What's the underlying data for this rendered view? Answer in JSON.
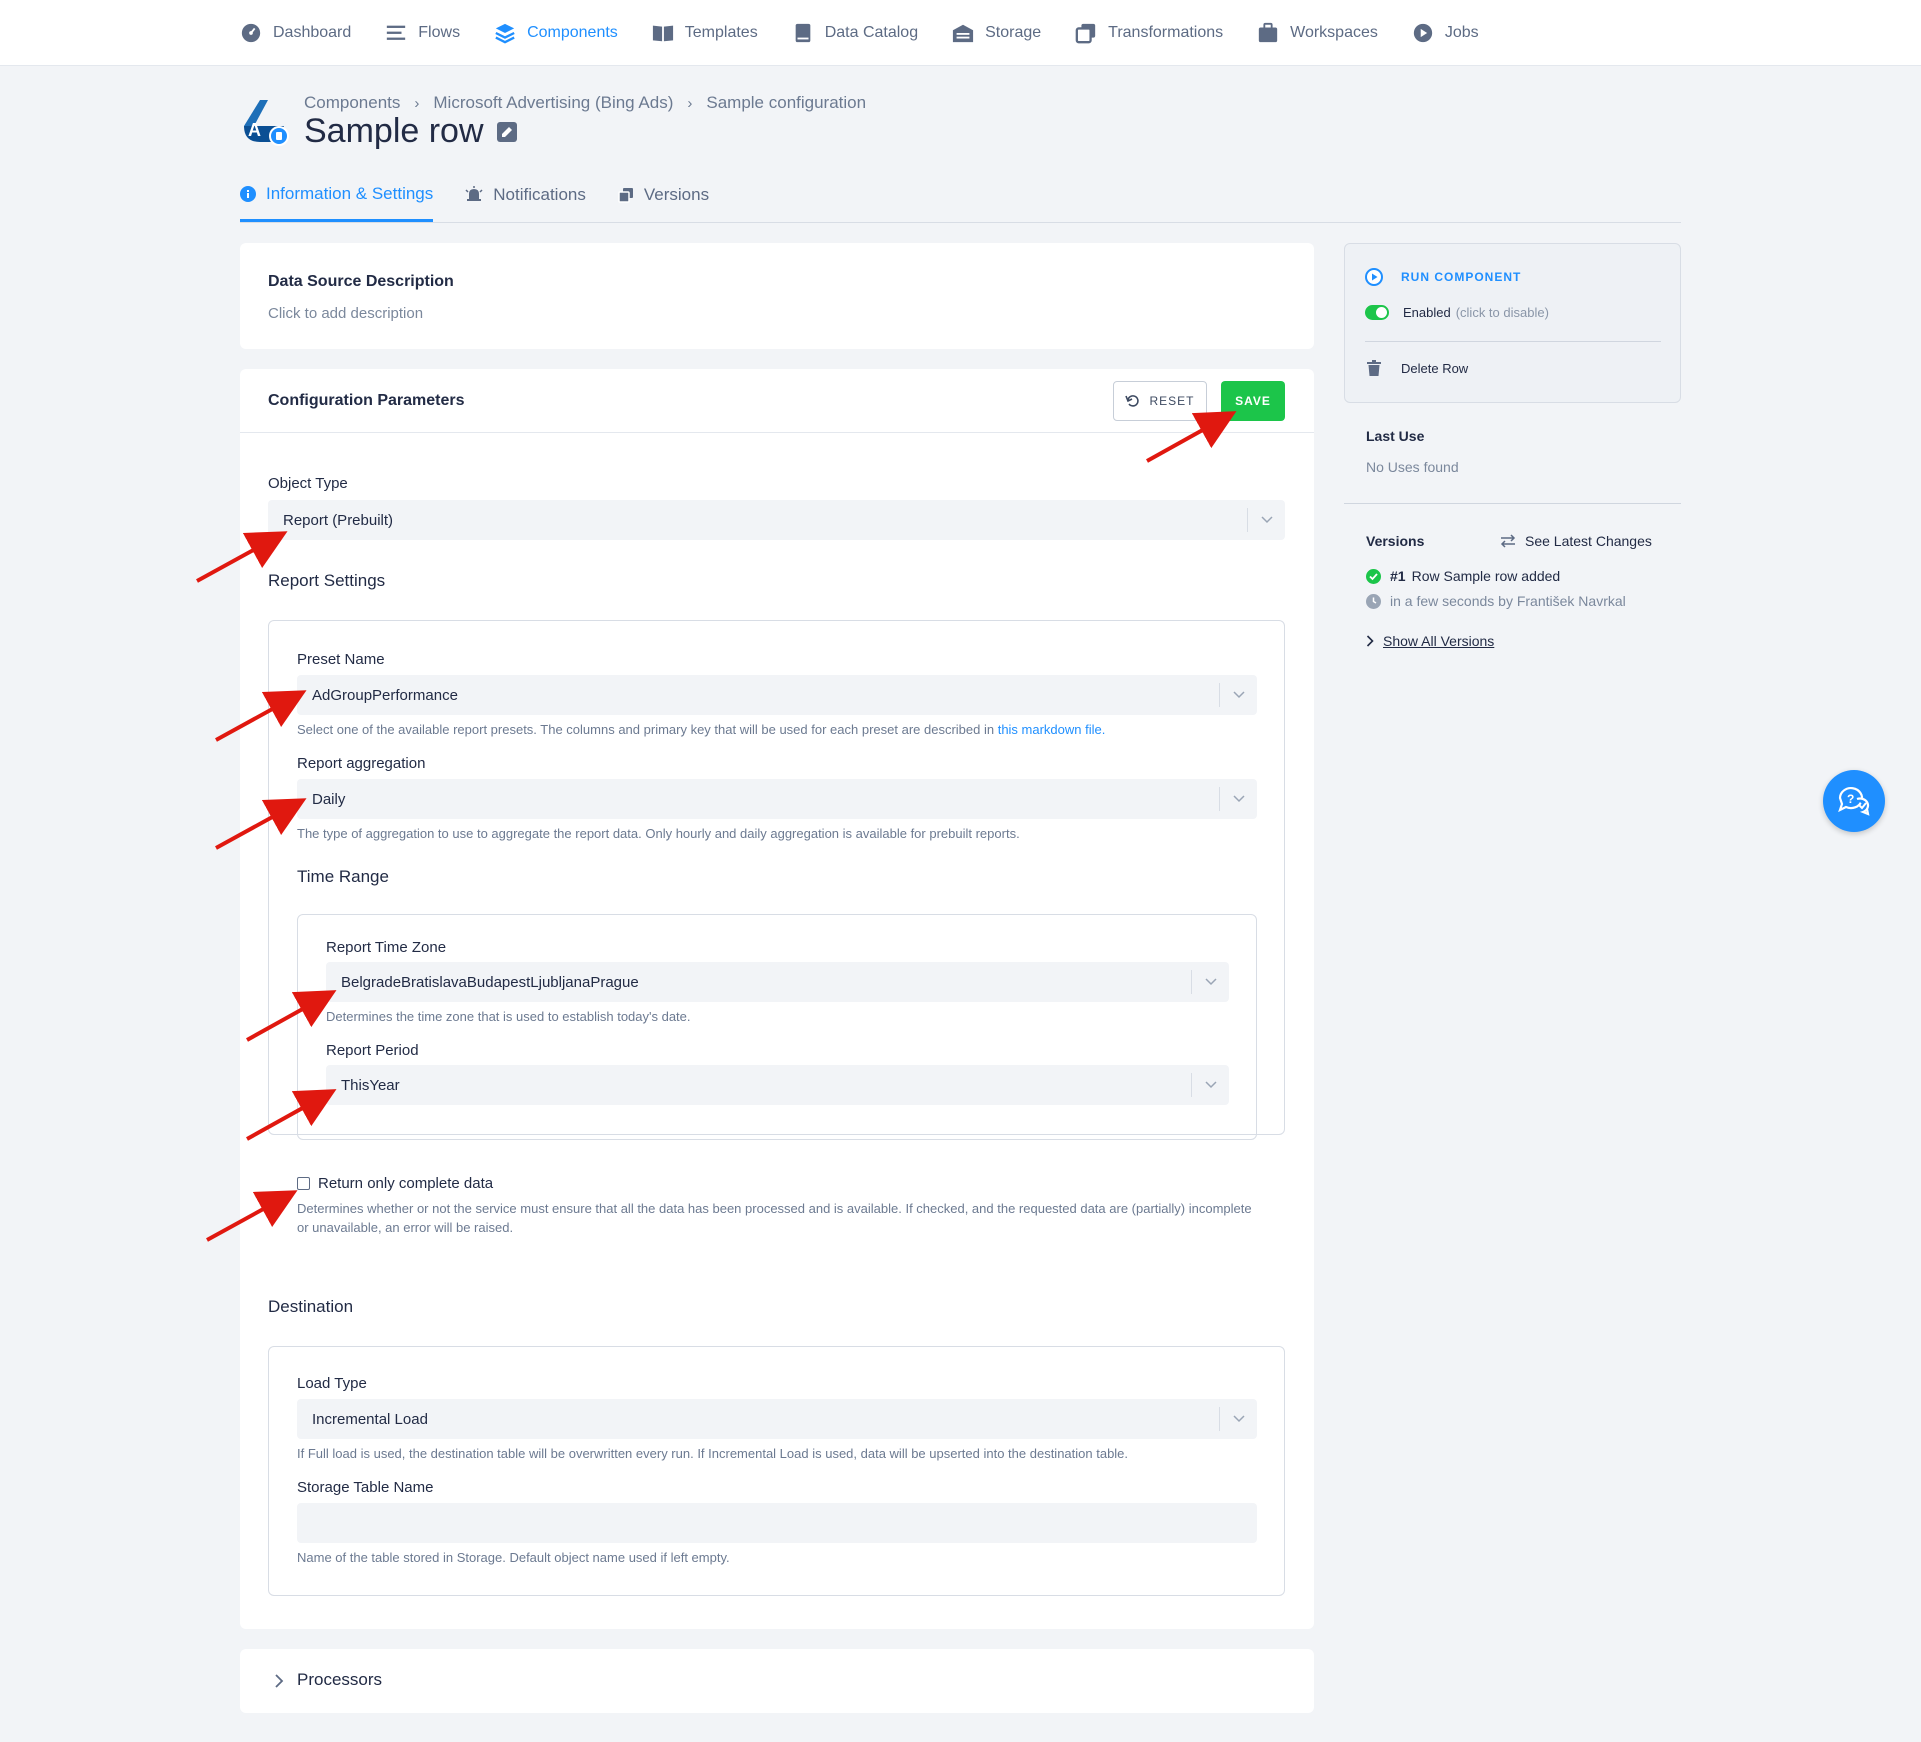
{
  "nav": [
    {
      "label": "Dashboard",
      "icon": "dashboard-icon"
    },
    {
      "label": "Flows",
      "icon": "flows-icon"
    },
    {
      "label": "Components",
      "icon": "components-icon",
      "active": true
    },
    {
      "label": "Templates",
      "icon": "templates-icon"
    },
    {
      "label": "Data Catalog",
      "icon": "data-catalog-icon"
    },
    {
      "label": "Storage",
      "icon": "storage-icon"
    },
    {
      "label": "Transformations",
      "icon": "transformations-icon"
    },
    {
      "label": "Workspaces",
      "icon": "workspaces-icon"
    },
    {
      "label": "Jobs",
      "icon": "jobs-icon"
    }
  ],
  "breadcrumb": {
    "items": [
      "Components",
      "Microsoft Advertising (Bing Ads)",
      "Sample configuration"
    ]
  },
  "page": {
    "title": "Sample row"
  },
  "tabs": [
    {
      "label": "Information & Settings",
      "active": true
    },
    {
      "label": "Notifications"
    },
    {
      "label": "Versions"
    }
  ],
  "description": {
    "title": "Data Source Description",
    "placeholder": "Click to add description"
  },
  "config": {
    "title": "Configuration Parameters",
    "reset_label": "RESET",
    "save_label": "SAVE",
    "object_type_label": "Object Type",
    "object_type_value": "Report (Prebuilt)",
    "report_settings_title": "Report Settings",
    "preset_name_label": "Preset Name",
    "preset_name_value": "AdGroupPerformance",
    "preset_help": "Select one of the available report presets. The columns and primary key that will be used for each preset are described in ",
    "preset_help_link": "this markdown file.",
    "aggregation_label": "Report aggregation",
    "aggregation_value": "Daily",
    "aggregation_help": "The type of aggregation to use to aggregate the report data. Only hourly and daily aggregation is available for prebuilt reports.",
    "time_range_title": "Time Range",
    "timezone_label": "Report Time Zone",
    "timezone_value": "BelgradeBratislavaBudapestLjubljanaPrague",
    "timezone_help": "Determines the time zone that is used to establish today's date.",
    "period_label": "Report Period",
    "period_value": "ThisYear",
    "complete_label": "Return only complete data",
    "complete_checked": false,
    "complete_help": "Determines whether or not the service must ensure that all the data has been processed and is available. If checked, and the requested data are (partially) incomplete or unavailable, an error will be raised.",
    "destination_title": "Destination",
    "load_type_label": "Load Type",
    "load_type_value": "Incremental Load",
    "load_type_help": "If Full load is used, the destination table will be overwritten every run. If Incremental Load is used, data will be upserted into the destination table.",
    "table_name_label": "Storage Table Name",
    "table_name_value": "",
    "table_name_help": "Name of the table stored in Storage. Default object name used if left empty."
  },
  "processors": {
    "title": "Processors"
  },
  "side": {
    "run_label": "RUN COMPONENT",
    "enabled_label": "Enabled",
    "enabled_hint": "(click to disable)",
    "delete_label": "Delete Row",
    "last_use_title": "Last Use",
    "last_use_value": "No Uses found",
    "versions_title": "Versions",
    "see_changes": "See Latest Changes",
    "version_number": "#1",
    "version_desc": "Row Sample row added",
    "version_meta": "in a few seconds by František Navrkal",
    "show_all": "Show All Versions"
  },
  "colors": {
    "accent": "#1f8fff",
    "save": "#1cc54a",
    "annotation_arrow": "#e0180f"
  }
}
